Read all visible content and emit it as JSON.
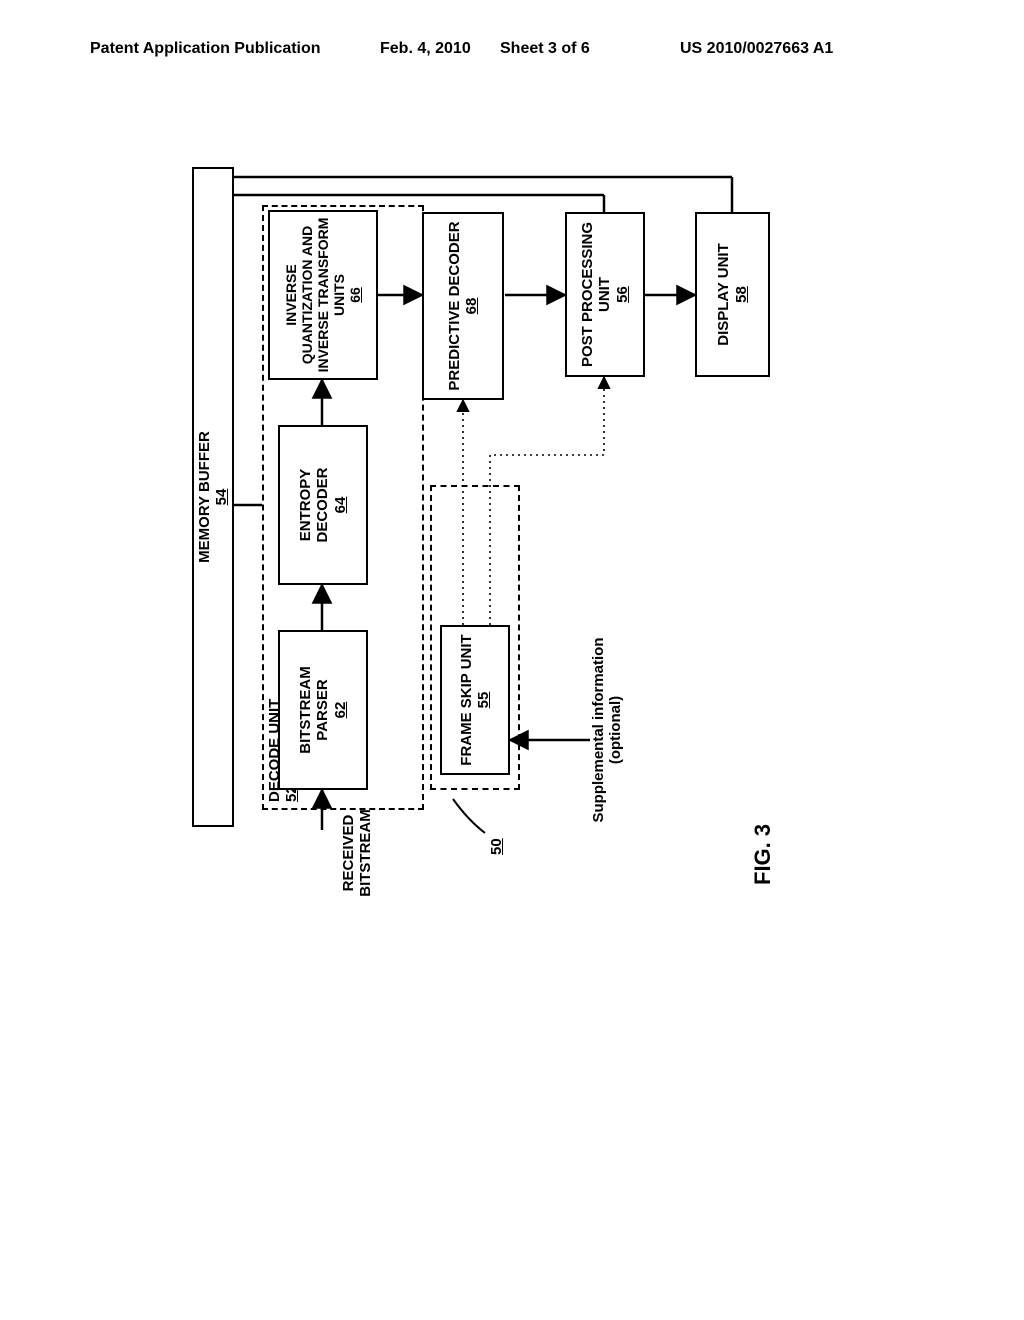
{
  "header": {
    "left": "Patent Application Publication",
    "date": "Feb. 4, 2010",
    "sheet": "Sheet 3 of 6",
    "pubno": "US 2010/0027663 A1"
  },
  "fig": "FIG. 3",
  "system_ref": "50",
  "received": {
    "l1": "RECEIVED",
    "l2": "BITSTREAM"
  },
  "membuf": {
    "name": "MEMORY BUFFER",
    "ref": "54"
  },
  "decode": {
    "name": "DECODE UNIT",
    "ref": "52"
  },
  "parser": {
    "name": "BITSTREAM PARSER",
    "ref": "62"
  },
  "entropy": {
    "name": "ENTROPY DECODER",
    "ref": "64"
  },
  "iqit": {
    "l1": "INVERSE",
    "l2": "QUANTIZATION AND",
    "l3": "INVERSE TRANSFORM",
    "l4": "UNITS",
    "ref": "66"
  },
  "pred": {
    "name": "PREDICTIVE DECODER",
    "ref": "68"
  },
  "frameskip": {
    "name": "FRAME SKIP UNIT",
    "ref": "55"
  },
  "post": {
    "l1": "POST PROCESSING",
    "l2": "UNIT",
    "ref": "56"
  },
  "display": {
    "name": "DISPLAY UNIT",
    "ref": "58"
  },
  "supp": {
    "l1": "Supplemental information",
    "l2": "(optional)"
  }
}
